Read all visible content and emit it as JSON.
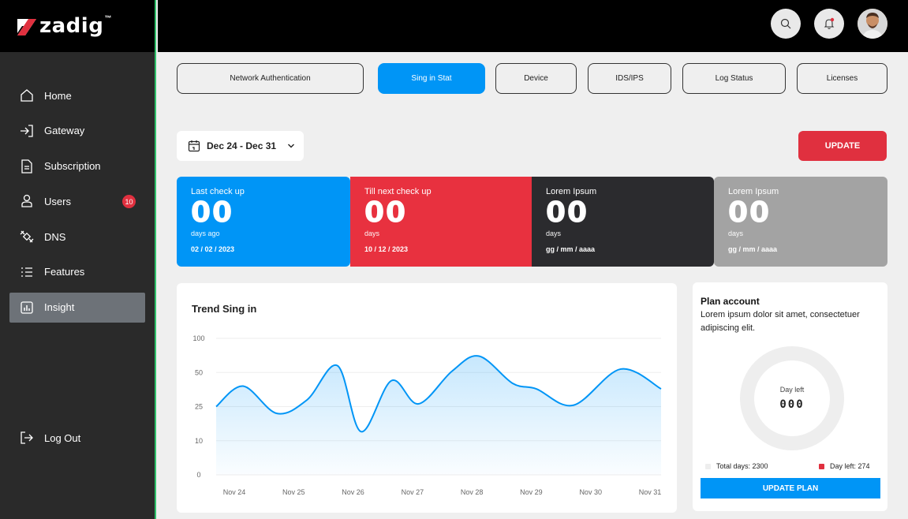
{
  "brand": {
    "name": "zadig",
    "tm": "™"
  },
  "sidebar": {
    "items": [
      {
        "label": "Home",
        "icon": "home-icon"
      },
      {
        "label": "Gateway",
        "icon": "gateway-icon"
      },
      {
        "label": "Subscription",
        "icon": "subscription-icon"
      },
      {
        "label": "Users",
        "icon": "user-icon",
        "badge": "10"
      },
      {
        "label": "DNS",
        "icon": "satellite-icon"
      },
      {
        "label": "Features",
        "icon": "list-icon"
      },
      {
        "label": "Insight",
        "icon": "chart-icon",
        "active": true
      }
    ],
    "logout": "Log Out"
  },
  "tabs": [
    {
      "label": "Network Authentication"
    },
    {
      "label": "Sing in Stat",
      "active": true
    },
    {
      "label": "Device"
    },
    {
      "label": "IDS/IPS"
    },
    {
      "label": "Log Status"
    },
    {
      "label": "Licenses"
    }
  ],
  "filters": {
    "date_range": "Dec 24 - Dec 31",
    "update_label": "UPDATE"
  },
  "stats": [
    {
      "label": "Last check up",
      "value": "00",
      "unit": "days ago",
      "date": "02 / 02 / 2023",
      "color": "#0095f6"
    },
    {
      "label": "Till next check up",
      "value": "00",
      "unit": "days",
      "date": "10 / 12 / 2023",
      "color": "#e8313f"
    },
    {
      "label": "Lorem Ipsum",
      "value": "00",
      "unit": "days",
      "date": "gg / mm / aaaa",
      "color": "#2b2b2e"
    },
    {
      "label": "Lorem Ipsum",
      "value": "00",
      "unit": "days",
      "date": "gg / mm / aaaa",
      "color": "#a3a3a3"
    }
  ],
  "chart_data": {
    "type": "area",
    "title": "Trend Sing in",
    "y_ticks": [
      "100",
      "50",
      "25",
      "10",
      "0"
    ],
    "x_ticks": [
      "Nov 24",
      "Nov 25",
      "Nov 26",
      "Nov 27",
      "Nov 28",
      "Nov 29",
      "Nov 30",
      "Nov 31"
    ],
    "series": [
      {
        "color": "#0095f6",
        "points": [
          [
            0.0,
            25
          ],
          [
            0.4,
            40
          ],
          [
            0.9,
            22
          ],
          [
            1.35,
            30
          ],
          [
            1.8,
            60
          ],
          [
            2.15,
            14
          ],
          [
            2.6,
            44
          ],
          [
            3.0,
            27
          ],
          [
            3.5,
            52
          ],
          [
            3.9,
            74
          ],
          [
            4.4,
            42
          ],
          [
            4.75,
            38
          ],
          [
            5.3,
            26
          ],
          [
            6.0,
            55
          ],
          [
            6.6,
            38
          ]
        ]
      }
    ]
  },
  "plan": {
    "title": "Plan account",
    "description": "Lorem ipsum dolor sit amet, consectetuer adipiscing elit.",
    "day_left_label": "Day left",
    "day_left_value": "000",
    "total_days": "Total days: 2300",
    "day_left_legend": "Day left: 274",
    "update_plan": "UPDATE PLAN"
  }
}
